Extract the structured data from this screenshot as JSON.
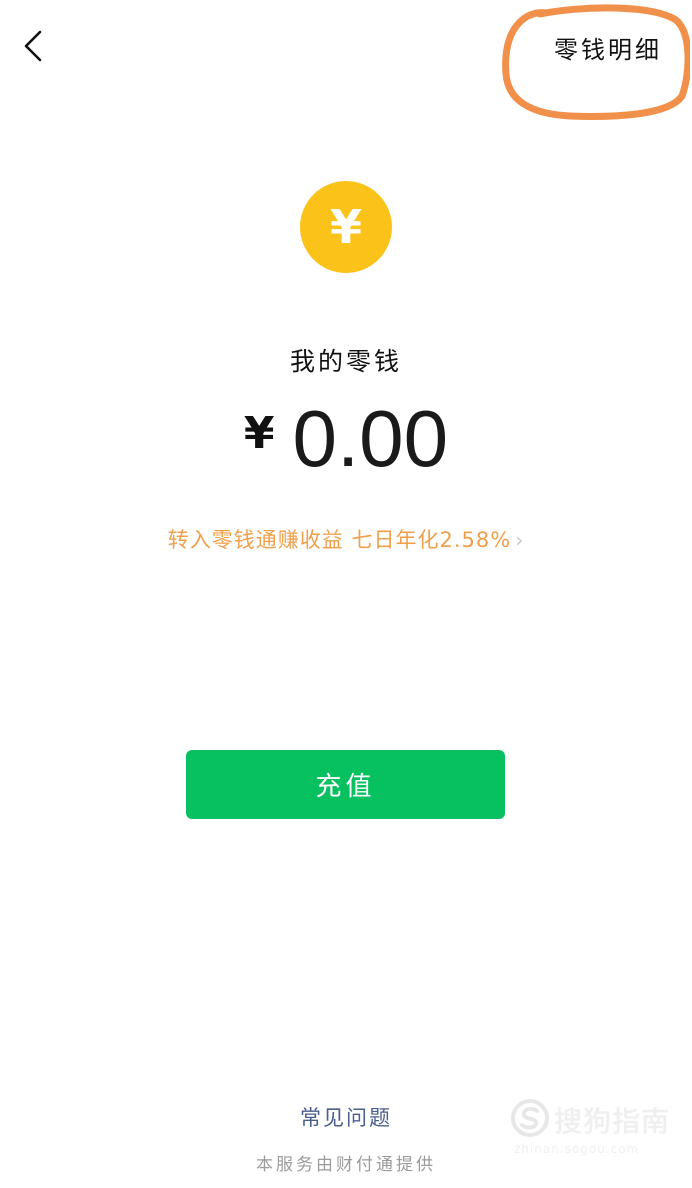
{
  "header": {
    "back_icon": "chevron-left-icon",
    "details_label": "零钱明细"
  },
  "wallet": {
    "coin_icon": "yuan-coin-icon",
    "coin_glyph": "¥",
    "label": "我的零钱",
    "currency_symbol": "¥",
    "amount": "0.00",
    "promo_text": "转入零钱通赚收益 七日年化2.58%",
    "promo_chevron": "›"
  },
  "actions": {
    "recharge_label": "充值"
  },
  "footer": {
    "faq_label": "常见问题",
    "provider_text": "本服务由财付通提供"
  },
  "watermark": {
    "brand": "搜狗指南",
    "url": "zhinan.sogou.com"
  },
  "colors": {
    "coin": "#FBC21A",
    "primary_button": "#07C160",
    "promo_text": "#F0A04B",
    "link": "#4A5F8E",
    "annotation": "#F0904A"
  }
}
